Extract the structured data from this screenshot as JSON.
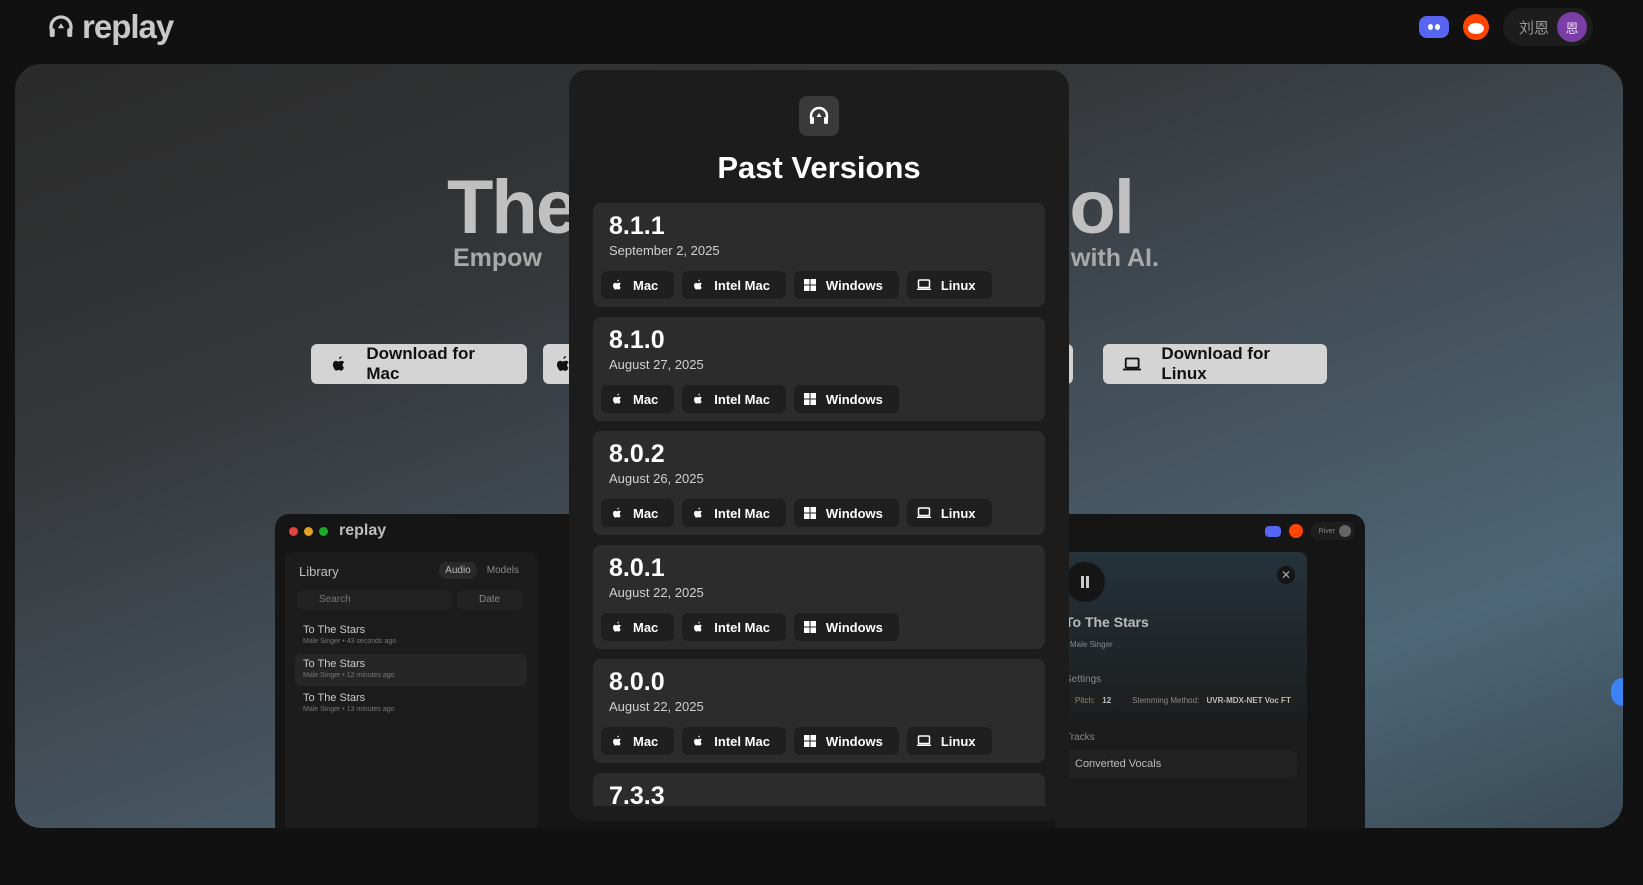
{
  "brand": {
    "name": "replay"
  },
  "header": {
    "user_name": "刘恩",
    "avatar_initial": "恩"
  },
  "hero": {
    "title_left": "The",
    "title_right": "ool",
    "subtitle_left": "Empow",
    "subtitle_right": "with AI.",
    "buttons": {
      "mac": "Download for Mac",
      "linux": "Download for Linux"
    }
  },
  "app_preview": {
    "logo": "replay",
    "library_title": "Library",
    "tabs": [
      "Audio",
      "Models"
    ],
    "search_placeholder": "Search",
    "sort_label": "Date",
    "items": [
      {
        "title": "To The Stars",
        "sub": "Male Singer • 43 seconds ago"
      },
      {
        "title": "To The Stars",
        "sub": "Male Singer • 12 minutes ago"
      },
      {
        "title": "To The Stars",
        "sub": "Male Singer • 13 minutes ago"
      }
    ],
    "user": "River",
    "detail": {
      "title": "To The Stars",
      "singer": "Male Singer",
      "settings_label": "Settings",
      "pitch_label": "Pitch:",
      "pitch_value": "12",
      "method_label": "Stemming Method:",
      "method_value": "UVR-MDX-NET Voc FT",
      "tracks_label": "Tracks",
      "track_name": "Converted Vocals"
    }
  },
  "modal": {
    "title": "Past Versions",
    "versions": [
      {
        "version": "8.1.1",
        "date": "September 2, 2025",
        "platforms": [
          "Mac",
          "Intel Mac",
          "Windows",
          "Linux"
        ]
      },
      {
        "version": "8.1.0",
        "date": "August 27, 2025",
        "platforms": [
          "Mac",
          "Intel Mac",
          "Windows"
        ]
      },
      {
        "version": "8.0.2",
        "date": "August 26, 2025",
        "platforms": [
          "Mac",
          "Intel Mac",
          "Windows",
          "Linux"
        ]
      },
      {
        "version": "8.0.1",
        "date": "August 22, 2025",
        "platforms": [
          "Mac",
          "Intel Mac",
          "Windows"
        ]
      },
      {
        "version": "8.0.0",
        "date": "August 22, 2025",
        "platforms": [
          "Mac",
          "Intel Mac",
          "Windows",
          "Linux"
        ]
      },
      {
        "version": "7.3.3",
        "date": "",
        "platforms": []
      }
    ]
  },
  "colors": {
    "discord": "#5865f2",
    "reddit": "#ff4500",
    "avatar": "#7b3ea6",
    "accent_blue": "#3b82f6"
  }
}
